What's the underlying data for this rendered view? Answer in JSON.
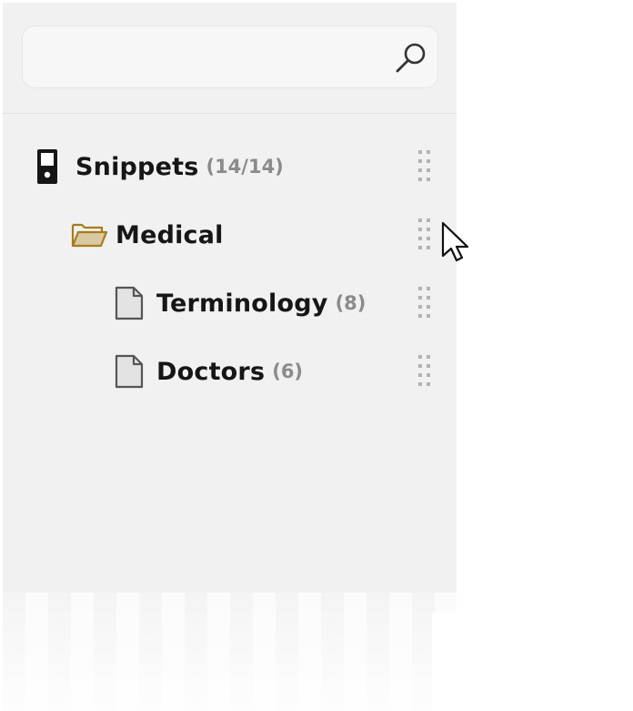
{
  "search": {
    "value": "",
    "placeholder": ""
  },
  "tree": {
    "root": {
      "label": "Snippets",
      "count": "(14/14)",
      "icon": "phone-device-icon"
    },
    "folder": {
      "label": "Medical",
      "icon": "open-folder-icon"
    },
    "files": [
      {
        "label": "Terminology",
        "count": "(8)",
        "icon": "document-icon"
      },
      {
        "label": "Doctors",
        "count": "(6)",
        "icon": "document-icon"
      }
    ]
  },
  "colors": {
    "panel_background": "#f1f1f1",
    "text": "#161616",
    "count_text": "#8b8b8b",
    "folder_outline": "#a87b1c",
    "folder_fill": "#d8c9a3",
    "drag_dots": "#b3b3b3"
  }
}
